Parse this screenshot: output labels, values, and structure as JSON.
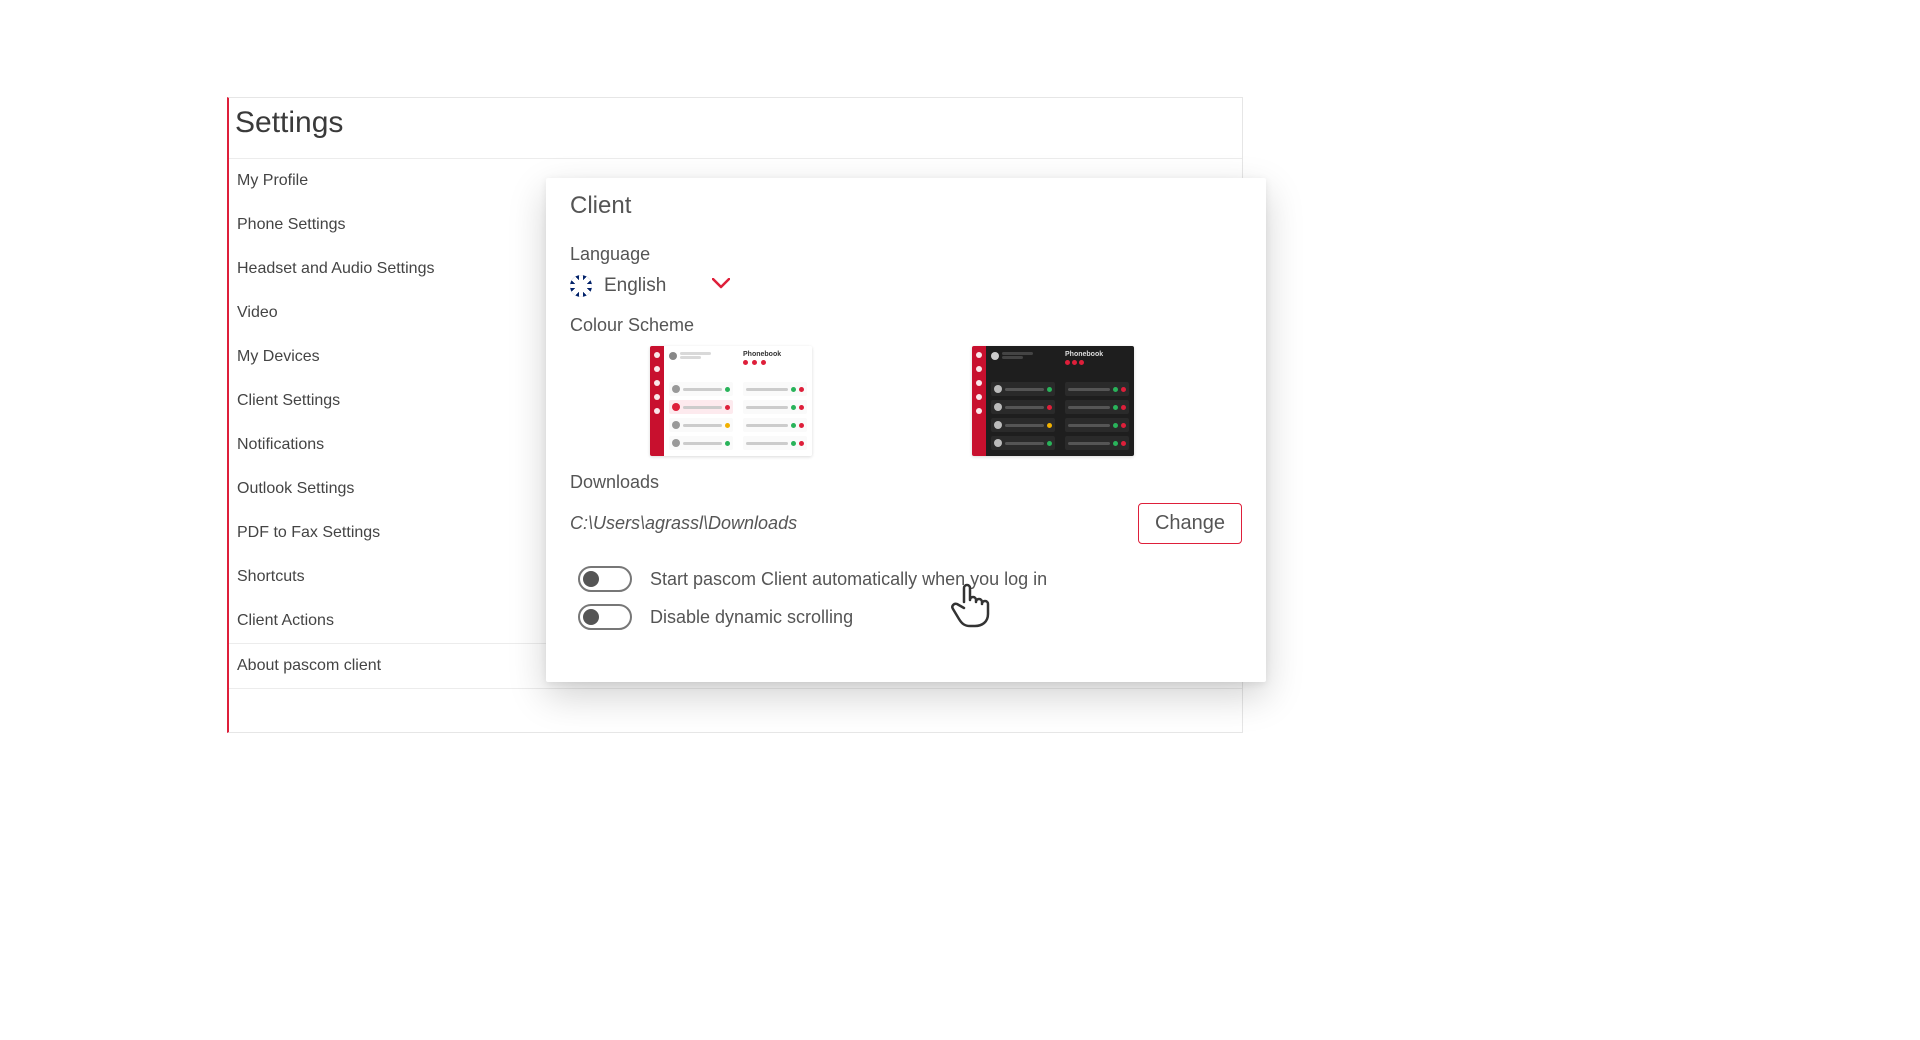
{
  "colors": {
    "accent": "#de1f3a"
  },
  "settings": {
    "title": "Settings",
    "nav": {
      "my_profile": "My Profile",
      "phone_settings": "Phone Settings",
      "headset_audio": "Headset and Audio Settings",
      "video": "Video",
      "my_devices": "My Devices",
      "client_settings": "Client Settings",
      "notifications": "Notifications",
      "outlook_settings": "Outlook Settings",
      "pdf_to_fax": "PDF to Fax Settings",
      "shortcuts": "Shortcuts",
      "client_actions": "Client Actions",
      "about": "About pascom client"
    }
  },
  "client": {
    "title": "Client",
    "language_label": "Language",
    "language_value": "English",
    "colour_scheme_label": "Colour Scheme",
    "scheme_preview_heading": "Phonebook",
    "downloads_label": "Downloads",
    "downloads_path": "C:\\Users\\agrassl\\Downloads",
    "change_button": "Change",
    "toggles": {
      "autostart": {
        "label": "Start pascom Client automatically when you log in",
        "enabled": false
      },
      "disable_scroll": {
        "label": "Disable dynamic scrolling",
        "enabled": false
      }
    }
  }
}
